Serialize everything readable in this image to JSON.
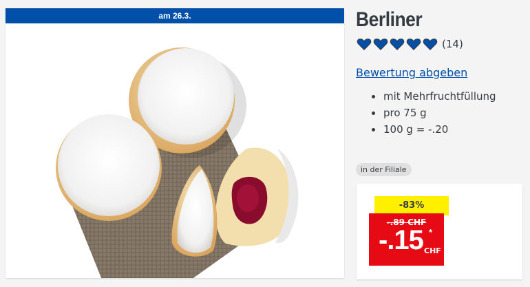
{
  "image": {
    "banner": "am 26.3."
  },
  "product": {
    "title": "Berliner",
    "rating_count": "(14)",
    "rate_link": "Bewertung abgeben",
    "features": [
      "mit Mehrfruchtfüllung",
      "pro 75 g",
      "100 g = -.20"
    ],
    "availability": "in der Filiale"
  },
  "rating": {
    "stars": 5,
    "max": 5,
    "color": "#0050aa"
  },
  "price": {
    "discount": "-83%",
    "old_price": "-.89 CHF",
    "new_price": "-.15",
    "asterisk": "*",
    "currency": "CHF"
  },
  "colors": {
    "brand_blue": "#0050aa",
    "price_red": "#e60a14",
    "discount_yellow": "#fff000"
  }
}
